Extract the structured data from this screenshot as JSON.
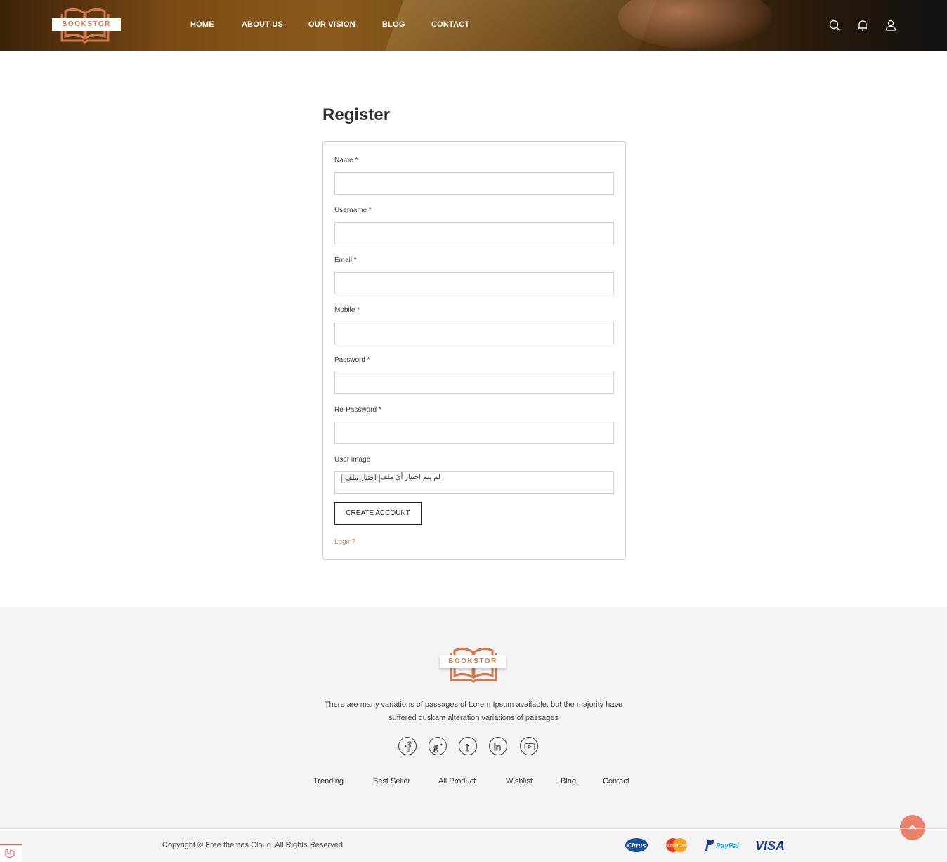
{
  "header": {
    "logo_text": "BOOKSTOR",
    "nav": [
      "HOME",
      "ABOUT US",
      "OUR VISION",
      "BLOG",
      "CONTACT"
    ]
  },
  "page": {
    "title": "Register"
  },
  "form": {
    "fields": [
      {
        "label": "Name *",
        "value": ""
      },
      {
        "label": "Username *",
        "value": ""
      },
      {
        "label": "Email *",
        "value": ""
      },
      {
        "label": "Mobile *",
        "value": ""
      },
      {
        "label": "Password *",
        "value": ""
      },
      {
        "label": "Re-Password *",
        "value": ""
      }
    ],
    "image_label": "User image",
    "file_button": "اختيار ملف",
    "file_status": "لم يتم اختيار أيّ ملف",
    "submit_label": "CREATE ACCOUNT",
    "login_link": "Login?"
  },
  "footer": {
    "logo_text": "BOOKSTOR",
    "description_line1": "There are many variations of passages of Lorem Ipsum available, but the majority have",
    "description_line2": "suffered duskam alteration variations of passages",
    "social": [
      "facebook-icon",
      "google-plus-icon",
      "tumblr-icon",
      "linkedin-icon",
      "youtube-icon"
    ],
    "links": [
      "Trending",
      "Best Seller",
      "All Product",
      "Wishlist",
      "Blog",
      "Contact"
    ],
    "copyright": "Copyright © Free themes Cloud. All Rights Reserved",
    "payments": [
      "Cirrus",
      "MasterCard",
      "PayPal",
      "VISA"
    ]
  },
  "colors": {
    "accent": "#d07a50",
    "scroll_top": "#e8826a",
    "footer_bg": "#f4f4f4"
  }
}
